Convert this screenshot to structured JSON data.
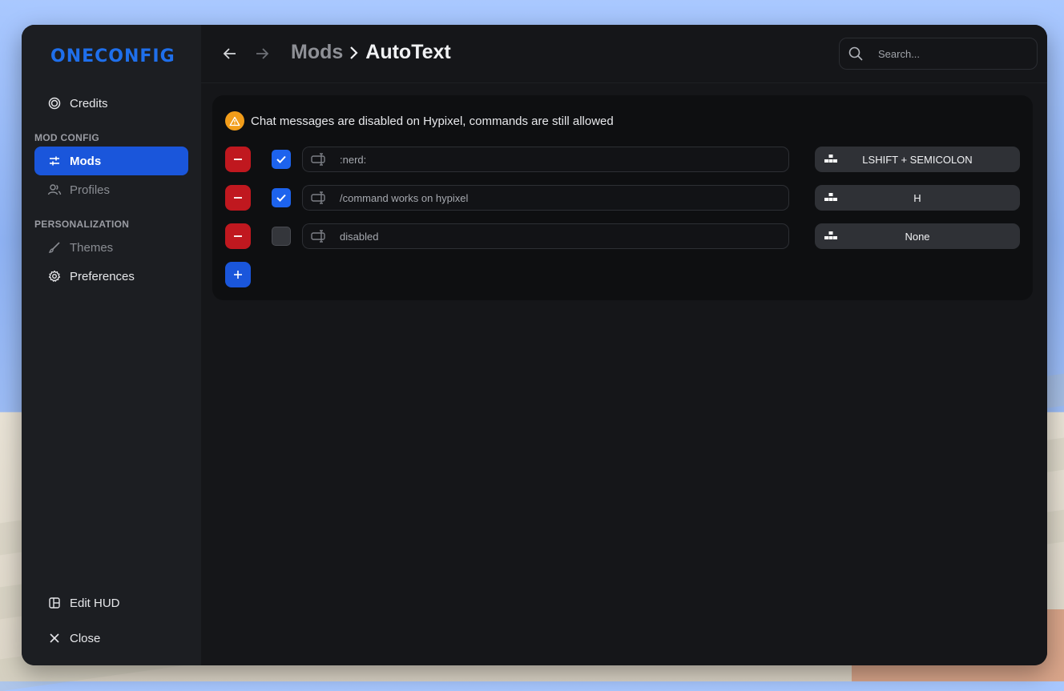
{
  "app": {
    "logo_text": "ONECONFIG"
  },
  "sidebar": {
    "top_items": [
      {
        "label": "Credits",
        "icon": "credits-icon"
      }
    ],
    "sections": [
      {
        "title": "MOD CONFIG",
        "items": [
          {
            "label": "Mods",
            "icon": "sliders-icon",
            "active": true
          },
          {
            "label": "Profiles",
            "icon": "users-icon"
          }
        ]
      },
      {
        "title": "PERSONALIZATION",
        "items": [
          {
            "label": "Themes",
            "icon": "brush-icon"
          },
          {
            "label": "Preferences",
            "icon": "gear-icon"
          }
        ]
      }
    ],
    "bottom_items": [
      {
        "label": "Edit HUD",
        "icon": "layout-icon"
      },
      {
        "label": "Close",
        "icon": "close-icon"
      }
    ]
  },
  "header": {
    "breadcrumb_parent": "Mods",
    "breadcrumb_current": "AutoText",
    "search_placeholder": "Search..."
  },
  "content": {
    "warning_text": "Chat messages are disabled on Hypixel, commands are still allowed",
    "rows": [
      {
        "enabled": true,
        "text": ":nerd:",
        "keybind": "LSHIFT + SEMICOLON"
      },
      {
        "enabled": true,
        "text": "/command works on hypixel",
        "keybind": "H"
      },
      {
        "enabled": false,
        "text": "disabled",
        "keybind": "None"
      }
    ]
  },
  "colors": {
    "accent": "#1a56db",
    "danger": "#c0181f",
    "warning": "#f29d1a"
  }
}
